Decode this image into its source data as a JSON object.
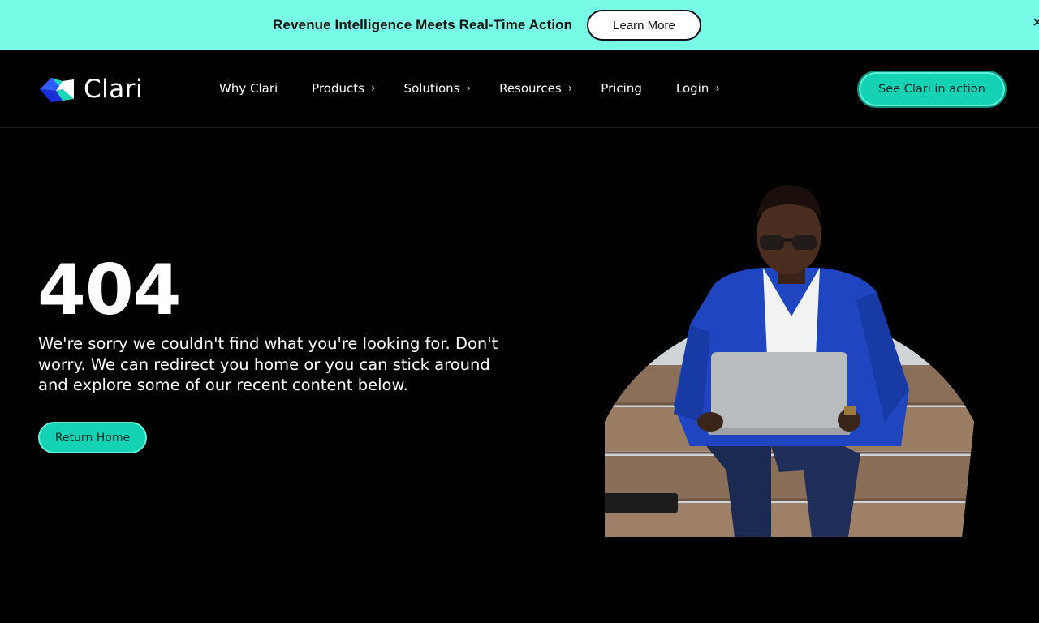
{
  "banner": {
    "text": "Revenue Intelligence Meets Real-Time Action",
    "button_label": "Learn More",
    "close_glyph": "×"
  },
  "nav": {
    "logo_text": "Clari",
    "items": [
      {
        "label": "Why Clari",
        "has_chevron": false
      },
      {
        "label": "Products",
        "has_chevron": true
      },
      {
        "label": "Solutions",
        "has_chevron": true
      },
      {
        "label": "Resources",
        "has_chevron": true
      },
      {
        "label": "Pricing",
        "has_chevron": false
      },
      {
        "label": "Login",
        "has_chevron": true
      }
    ],
    "chevron_glyph": "›",
    "cta_label": "See Clari in action"
  },
  "hero": {
    "title": "404",
    "message": "We're sorry we couldn't find what you're looking for. Don't worry. We can redirect you home or you can stick around and explore some of our recent content below.",
    "button_label": "Return Home"
  },
  "colors": {
    "banner_bg": "#78fbe6",
    "accent": "#14d3b4",
    "page_bg": "#000000",
    "logo_blue": "#2f5bff"
  },
  "icons": {
    "logo": "clari-logo-icon",
    "close": "close-icon",
    "chevron": "chevron-right-icon",
    "hero_image": "man-with-laptop-illustration"
  }
}
